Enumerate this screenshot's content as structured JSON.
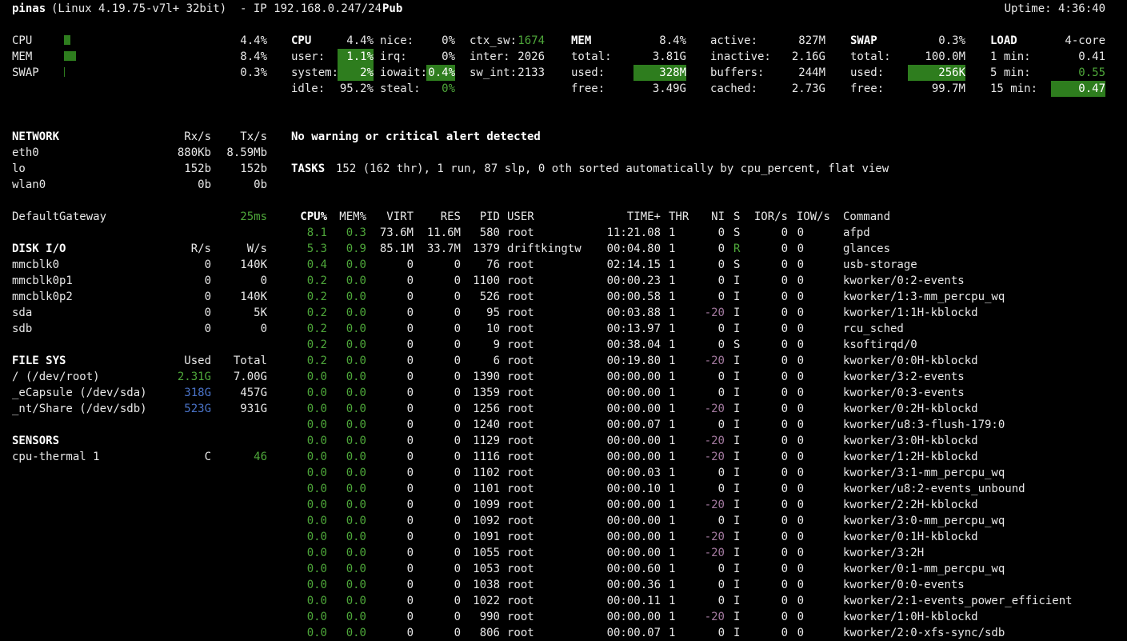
{
  "header": {
    "hostname": "pinas",
    "kernel": "(Linux 4.19.75-v7l+ 32bit)",
    "ip": "- IP 192.168.0.247/24",
    "pub": "Pub",
    "uptime": "Uptime: 4:36:40"
  },
  "quicklook": {
    "cpu_label": "CPU",
    "cpu_val": "4.4%",
    "cpu_pct": 4.4,
    "mem_label": "MEM",
    "mem_val": "8.4%",
    "mem_pct": 8.4,
    "swap_label": "SWAP",
    "swap_val": "0.3%",
    "swap_pct": 0.3
  },
  "cpu": {
    "title": "CPU",
    "total": "4.4%",
    "user_l": "user:",
    "user": "1.1%",
    "system_l": "system:",
    "system": "2%",
    "idle_l": "idle:",
    "idle": "95.2%",
    "nice_l": "nice:",
    "nice": "0%",
    "irq_l": "irq:",
    "irq": "0%",
    "iowait_l": "iowait:",
    "iowait": "0.4%",
    "steal_l": "steal:",
    "steal": "0%",
    "ctx_l": "ctx_sw:",
    "ctx": "1674",
    "inter_l": "inter:",
    "inter": "2026",
    "swint_l": "sw_int:",
    "swint": "2133"
  },
  "mem": {
    "title": "MEM",
    "pct": "8.4%",
    "total_l": "total:",
    "total": "3.81G",
    "used_l": "used:",
    "used": "328M",
    "free_l": "free:",
    "free": "3.49G",
    "active_l": "active:",
    "active": "827M",
    "inactive_l": "inactive:",
    "inactive": "2.16G",
    "buffers_l": "buffers:",
    "buffers": "244M",
    "cached_l": "cached:",
    "cached": "2.73G"
  },
  "swap": {
    "title": "SWAP",
    "pct": "0.3%",
    "total_l": "total:",
    "total": "100.0M",
    "used_l": "used:",
    "used": "256K",
    "free_l": "free:",
    "free": "99.7M"
  },
  "load": {
    "title": "LOAD",
    "cores": "4-core",
    "m1_l": "1 min:",
    "m1": "0.41",
    "m5_l": "5 min:",
    "m5": "0.55",
    "m15_l": "15 min:",
    "m15": "0.47"
  },
  "network": {
    "title": "NETWORK",
    "rx_h": "Rx/s",
    "tx_h": "Tx/s",
    "rows": [
      {
        "name": "eth0",
        "rx": "880Kb",
        "tx": "8.59Mb"
      },
      {
        "name": "lo",
        "rx": "152b",
        "tx": "152b"
      },
      {
        "name": "wlan0",
        "rx": "0b",
        "tx": "0b"
      }
    ]
  },
  "gateway": {
    "label": "DefaultGateway",
    "value": "25ms"
  },
  "disk": {
    "title": "DISK I/O",
    "r_h": "R/s",
    "w_h": "W/s",
    "rows": [
      {
        "name": "mmcblk0",
        "r": "0",
        "w": "140K"
      },
      {
        "name": "mmcblk0p1",
        "r": "0",
        "w": "0"
      },
      {
        "name": "mmcblk0p2",
        "r": "0",
        "w": "140K"
      },
      {
        "name": "sda",
        "r": "0",
        "w": "5K"
      },
      {
        "name": "sdb",
        "r": "0",
        "w": "0"
      }
    ]
  },
  "fs": {
    "title": "FILE SYS",
    "used_h": "Used",
    "total_h": "Total",
    "rows": [
      {
        "name": "/ (/dev/root)",
        "used": "2.31G",
        "total": "7.00G"
      },
      {
        "name": "_eCapsule (/dev/sda)",
        "used": "318G",
        "total": "457G"
      },
      {
        "name": "_nt/Share (/dev/sdb)",
        "used": "523G",
        "total": "931G"
      }
    ]
  },
  "sensors": {
    "title": "SENSORS",
    "rows": [
      {
        "name": "cpu-thermal 1",
        "unit": "C",
        "value": "46"
      }
    ]
  },
  "alert": "No warning or critical alert detected",
  "tasks": {
    "label": "TASKS",
    "summary": "152 (162 thr), 1 run, 87 slp, 0 oth sorted automatically by cpu_percent, flat view"
  },
  "process_headers": {
    "cpu": "CPU%",
    "mem": "MEM%",
    "virt": "VIRT",
    "res": "RES",
    "pid": "PID",
    "user": "USER",
    "time": "TIME+",
    "thr": "THR",
    "ni": "NI",
    "s": "S",
    "ior": "IOR/s",
    "iow": "IOW/s",
    "cmd": "Command"
  },
  "processes": [
    {
      "cpu": "8.1",
      "mem": "0.3",
      "virt": "73.6M",
      "res": "11.6M",
      "pid": "580",
      "user": "root",
      "time": "11:21.08",
      "thr": "1",
      "ni": "0",
      "s": "S",
      "ior": "0",
      "iow": "0",
      "cmd": "afpd"
    },
    {
      "cpu": "5.3",
      "mem": "0.9",
      "virt": "85.1M",
      "res": "33.7M",
      "pid": "1379",
      "user": "driftkingtw",
      "time": "00:04.80",
      "thr": "1",
      "ni": "0",
      "s": "R",
      "ior": "0",
      "iow": "0",
      "cmd": "glances"
    },
    {
      "cpu": "0.4",
      "mem": "0.0",
      "virt": "0",
      "res": "0",
      "pid": "76",
      "user": "root",
      "time": "02:14.15",
      "thr": "1",
      "ni": "0",
      "s": "S",
      "ior": "0",
      "iow": "0",
      "cmd": "usb-storage"
    },
    {
      "cpu": "0.2",
      "mem": "0.0",
      "virt": "0",
      "res": "0",
      "pid": "1100",
      "user": "root",
      "time": "00:00.23",
      "thr": "1",
      "ni": "0",
      "s": "I",
      "ior": "0",
      "iow": "0",
      "cmd": "kworker/0:2-events"
    },
    {
      "cpu": "0.2",
      "mem": "0.0",
      "virt": "0",
      "res": "0",
      "pid": "526",
      "user": "root",
      "time": "00:00.58",
      "thr": "1",
      "ni": "0",
      "s": "I",
      "ior": "0",
      "iow": "0",
      "cmd": "kworker/1:3-mm_percpu_wq"
    },
    {
      "cpu": "0.2",
      "mem": "0.0",
      "virt": "0",
      "res": "0",
      "pid": "95",
      "user": "root",
      "time": "00:03.88",
      "thr": "1",
      "ni": "-20",
      "s": "I",
      "ior": "0",
      "iow": "0",
      "cmd": "kworker/1:1H-kblockd"
    },
    {
      "cpu": "0.2",
      "mem": "0.0",
      "virt": "0",
      "res": "0",
      "pid": "10",
      "user": "root",
      "time": "00:13.97",
      "thr": "1",
      "ni": "0",
      "s": "I",
      "ior": "0",
      "iow": "0",
      "cmd": "rcu_sched"
    },
    {
      "cpu": "0.2",
      "mem": "0.0",
      "virt": "0",
      "res": "0",
      "pid": "9",
      "user": "root",
      "time": "00:38.04",
      "thr": "1",
      "ni": "0",
      "s": "S",
      "ior": "0",
      "iow": "0",
      "cmd": "ksoftirqd/0"
    },
    {
      "cpu": "0.2",
      "mem": "0.0",
      "virt": "0",
      "res": "0",
      "pid": "6",
      "user": "root",
      "time": "00:19.80",
      "thr": "1",
      "ni": "-20",
      "s": "I",
      "ior": "0",
      "iow": "0",
      "cmd": "kworker/0:0H-kblockd"
    },
    {
      "cpu": "0.0",
      "mem": "0.0",
      "virt": "0",
      "res": "0",
      "pid": "1390",
      "user": "root",
      "time": "00:00.00",
      "thr": "1",
      "ni": "0",
      "s": "I",
      "ior": "0",
      "iow": "0",
      "cmd": "kworker/3:2-events"
    },
    {
      "cpu": "0.0",
      "mem": "0.0",
      "virt": "0",
      "res": "0",
      "pid": "1359",
      "user": "root",
      "time": "00:00.00",
      "thr": "1",
      "ni": "0",
      "s": "I",
      "ior": "0",
      "iow": "0",
      "cmd": "kworker/0:3-events"
    },
    {
      "cpu": "0.0",
      "mem": "0.0",
      "virt": "0",
      "res": "0",
      "pid": "1256",
      "user": "root",
      "time": "00:00.00",
      "thr": "1",
      "ni": "-20",
      "s": "I",
      "ior": "0",
      "iow": "0",
      "cmd": "kworker/0:2H-kblockd"
    },
    {
      "cpu": "0.0",
      "mem": "0.0",
      "virt": "0",
      "res": "0",
      "pid": "1240",
      "user": "root",
      "time": "00:00.07",
      "thr": "1",
      "ni": "0",
      "s": "I",
      "ior": "0",
      "iow": "0",
      "cmd": "kworker/u8:3-flush-179:0"
    },
    {
      "cpu": "0.0",
      "mem": "0.0",
      "virt": "0",
      "res": "0",
      "pid": "1129",
      "user": "root",
      "time": "00:00.00",
      "thr": "1",
      "ni": "-20",
      "s": "I",
      "ior": "0",
      "iow": "0",
      "cmd": "kworker/3:0H-kblockd"
    },
    {
      "cpu": "0.0",
      "mem": "0.0",
      "virt": "0",
      "res": "0",
      "pid": "1116",
      "user": "root",
      "time": "00:00.00",
      "thr": "1",
      "ni": "-20",
      "s": "I",
      "ior": "0",
      "iow": "0",
      "cmd": "kworker/1:2H-kblockd"
    },
    {
      "cpu": "0.0",
      "mem": "0.0",
      "virt": "0",
      "res": "0",
      "pid": "1102",
      "user": "root",
      "time": "00:00.03",
      "thr": "1",
      "ni": "0",
      "s": "I",
      "ior": "0",
      "iow": "0",
      "cmd": "kworker/3:1-mm_percpu_wq"
    },
    {
      "cpu": "0.0",
      "mem": "0.0",
      "virt": "0",
      "res": "0",
      "pid": "1101",
      "user": "root",
      "time": "00:00.10",
      "thr": "1",
      "ni": "0",
      "s": "I",
      "ior": "0",
      "iow": "0",
      "cmd": "kworker/u8:2-events_unbound"
    },
    {
      "cpu": "0.0",
      "mem": "0.0",
      "virt": "0",
      "res": "0",
      "pid": "1099",
      "user": "root",
      "time": "00:00.00",
      "thr": "1",
      "ni": "-20",
      "s": "I",
      "ior": "0",
      "iow": "0",
      "cmd": "kworker/2:2H-kblockd"
    },
    {
      "cpu": "0.0",
      "mem": "0.0",
      "virt": "0",
      "res": "0",
      "pid": "1092",
      "user": "root",
      "time": "00:00.00",
      "thr": "1",
      "ni": "0",
      "s": "I",
      "ior": "0",
      "iow": "0",
      "cmd": "kworker/3:0-mm_percpu_wq"
    },
    {
      "cpu": "0.0",
      "mem": "0.0",
      "virt": "0",
      "res": "0",
      "pid": "1091",
      "user": "root",
      "time": "00:00.00",
      "thr": "1",
      "ni": "-20",
      "s": "I",
      "ior": "0",
      "iow": "0",
      "cmd": "kworker/0:1H-kblockd"
    },
    {
      "cpu": "0.0",
      "mem": "0.0",
      "virt": "0",
      "res": "0",
      "pid": "1055",
      "user": "root",
      "time": "00:00.00",
      "thr": "1",
      "ni": "-20",
      "s": "I",
      "ior": "0",
      "iow": "0",
      "cmd": "kworker/3:2H"
    },
    {
      "cpu": "0.0",
      "mem": "0.0",
      "virt": "0",
      "res": "0",
      "pid": "1053",
      "user": "root",
      "time": "00:00.60",
      "thr": "1",
      "ni": "0",
      "s": "I",
      "ior": "0",
      "iow": "0",
      "cmd": "kworker/0:1-mm_percpu_wq"
    },
    {
      "cpu": "0.0",
      "mem": "0.0",
      "virt": "0",
      "res": "0",
      "pid": "1038",
      "user": "root",
      "time": "00:00.36",
      "thr": "1",
      "ni": "0",
      "s": "I",
      "ior": "0",
      "iow": "0",
      "cmd": "kworker/0:0-events"
    },
    {
      "cpu": "0.0",
      "mem": "0.0",
      "virt": "0",
      "res": "0",
      "pid": "1022",
      "user": "root",
      "time": "00:00.11",
      "thr": "1",
      "ni": "0",
      "s": "I",
      "ior": "0",
      "iow": "0",
      "cmd": "kworker/2:1-events_power_efficient"
    },
    {
      "cpu": "0.0",
      "mem": "0.0",
      "virt": "0",
      "res": "0",
      "pid": "990",
      "user": "root",
      "time": "00:00.00",
      "thr": "1",
      "ni": "-20",
      "s": "I",
      "ior": "0",
      "iow": "0",
      "cmd": "kworker/1:0H-kblockd"
    },
    {
      "cpu": "0.0",
      "mem": "0.0",
      "virt": "0",
      "res": "0",
      "pid": "806",
      "user": "root",
      "time": "00:00.07",
      "thr": "1",
      "ni": "0",
      "s": "I",
      "ior": "0",
      "iow": "0",
      "cmd": "kworker/2:0-xfs-sync/sdb"
    }
  ],
  "colors": {
    "background": "#000000",
    "text": "#e8e8e8",
    "ok_green": "#4ea73a",
    "bar_green": "#2e7d1e",
    "careful_blue": "#4a73c8",
    "nice_magenta": "#a47aa0"
  }
}
